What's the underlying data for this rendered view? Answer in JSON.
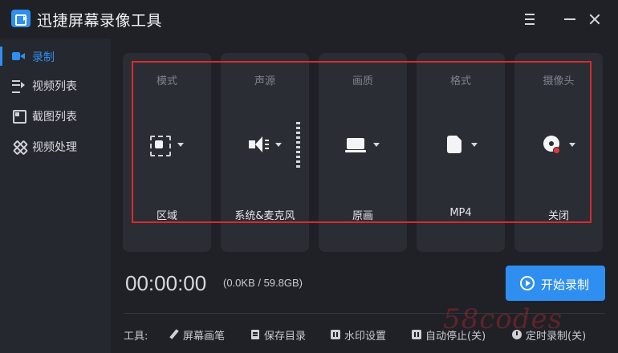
{
  "app": {
    "title": "迅捷屏幕录像工具"
  },
  "sidebar": {
    "items": [
      {
        "label": "录制",
        "icon": "record-icon",
        "active": true
      },
      {
        "label": "视频列表",
        "icon": "video-list-icon",
        "active": false
      },
      {
        "label": "截图列表",
        "icon": "screenshot-icon",
        "active": false
      },
      {
        "label": "视频处理",
        "icon": "tools-icon",
        "active": false
      }
    ]
  },
  "settings": {
    "mode": {
      "title": "模式",
      "value": "区域",
      "icon": "region-icon"
    },
    "audio": {
      "title": "声源",
      "value": "系统&麦克风",
      "icon": "speaker-icon"
    },
    "quality": {
      "title": "画质",
      "value": "原画",
      "icon": "monitor-icon"
    },
    "format": {
      "title": "格式",
      "value": "MP4",
      "icon": "file-icon"
    },
    "camera": {
      "title": "摄像头",
      "value": "关闭",
      "icon": "webcam-icon"
    }
  },
  "status": {
    "timer": "00:00:00",
    "size": "(0.0KB / 59.8GB)"
  },
  "start_button": {
    "label": "开始录制"
  },
  "toolbar": {
    "label": "工具:",
    "items": [
      {
        "label": "屏幕画笔",
        "icon": "pen-icon"
      },
      {
        "label": "保存目录",
        "icon": "folder-icon"
      },
      {
        "label": "水印设置",
        "icon": "watermark-icon"
      },
      {
        "label": "自动停止(关)",
        "icon": "auto-stop-icon"
      },
      {
        "label": "定时录制(关)",
        "icon": "clock-icon"
      }
    ]
  },
  "watermark": {
    "text": "58codes"
  },
  "colors": {
    "accent": "#2f8ff0",
    "highlight": "#d82a2f",
    "background": "#1f2127",
    "sidebar": "#25282e",
    "card": "#2a2d34"
  }
}
